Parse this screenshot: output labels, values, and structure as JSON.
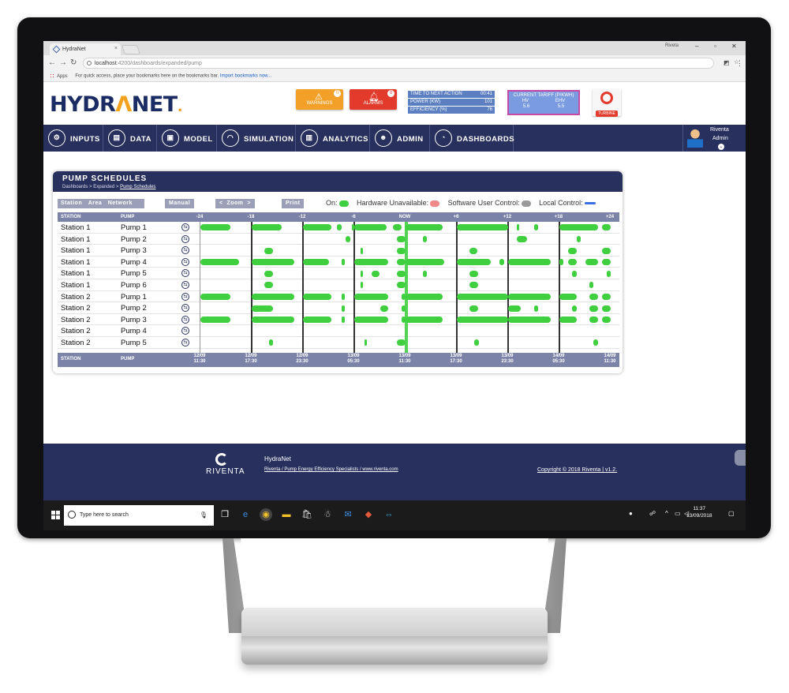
{
  "browser": {
    "tab_title": "HydraNet",
    "tab_close": "×",
    "user_badge": "Riveta",
    "url_host": "localhost",
    "url_path": ":4200/dashboards/expanded/pump",
    "bookmarks_apps": "Apps",
    "bookmarks_hint": "For quick access, place your bookmarks here on the bookmarks bar.",
    "bookmarks_import": "Import bookmarks now..."
  },
  "header": {
    "logo_pre": "HYDR",
    "logo_a": "Λ",
    "logo_post": "NET",
    "logo_dot": ".",
    "warnings_label": "WARNINGS",
    "warnings_count": "0",
    "alarms_label": "ALARMS",
    "alarms_count": "0",
    "stats": [
      {
        "label": "TIME TO NEXT ACTION",
        "value": "00:41"
      },
      {
        "label": "POWER (KW)",
        "value": "101"
      },
      {
        "label": "EFFICIENCY (%)",
        "value": "76"
      }
    ],
    "tariff_title": "CURRENT TARIFF (P/KWH)",
    "tariff_h1": "HV",
    "tariff_h2": "EHV",
    "tariff_v1": "5.6",
    "tariff_v2": "5.5",
    "turbine_label": "TURBINE"
  },
  "nav": {
    "items": [
      "INPUTS",
      "DATA",
      "MODEL",
      "SIMULATION",
      "ANALYTICS",
      "ADMIN",
      "DASHBOARDS"
    ],
    "user_name": "Riventa",
    "user_role": "Admin"
  },
  "panel": {
    "title": "PUMP SCHEDULES",
    "crumb": "Dashboards > Expanded > ",
    "crumb_current": "Pump Schedules",
    "btn_station": "Station",
    "btn_area": "Area",
    "btn_network": "Network",
    "btn_manual": "Manual",
    "btn_zoom": "<  Zoom  >",
    "btn_print": "Print",
    "legend_on": "On:",
    "legend_hw": "Hardware Unavailable:",
    "legend_sw": "Software User Control:",
    "legend_local": "Local Control:"
  },
  "grid": {
    "col_station": "STATION",
    "col_pump": "PUMP",
    "ticks": [
      "-24",
      "-18",
      "-12",
      "-6",
      "NOW",
      "+6",
      "+12",
      "+18",
      "+24"
    ],
    "foot_times": [
      [
        "12/09",
        "11:30"
      ],
      [
        "12/09",
        "17:30"
      ],
      [
        "12/09",
        "23:30"
      ],
      [
        "13/09",
        "05:30"
      ],
      [
        "13/09",
        "11:30"
      ],
      [
        "13/09",
        "17:30"
      ],
      [
        "13/09",
        "23:30"
      ],
      [
        "14/09",
        "05:30"
      ],
      [
        "14/09",
        "11:30"
      ]
    ],
    "rows": [
      {
        "station": "Station 1",
        "pump": "Pump 1",
        "on_hours": [
          [
            -24,
            -20.5
          ],
          [
            -18,
            -14.5
          ],
          [
            -12,
            -8.7
          ],
          [
            -8,
            -7.5
          ],
          [
            -6.3,
            -6
          ],
          [
            -6,
            -2.2
          ],
          [
            -1.5,
            -0.5
          ],
          [
            0,
            4.3
          ],
          [
            6,
            12
          ],
          [
            13,
            13.3
          ],
          [
            15,
            15.5
          ],
          [
            18,
            22.5
          ],
          [
            23,
            24
          ]
        ]
      },
      {
        "station": "Station 1",
        "pump": "Pump 2",
        "on_hours": [
          [
            -7,
            -6.5
          ],
          [
            -1,
            0
          ],
          [
            2,
            2.5
          ],
          [
            13,
            14.2
          ],
          [
            20,
            20.5
          ]
        ]
      },
      {
        "station": "Station 1",
        "pump": "Pump 3",
        "on_hours": [
          [
            -16.5,
            -15.5
          ],
          [
            -5.3,
            -5.1
          ],
          [
            -1,
            0
          ],
          [
            7.5,
            8.4
          ],
          [
            19,
            20
          ],
          [
            23,
            24
          ]
        ]
      },
      {
        "station": "Station 1",
        "pump": "Pump 4",
        "on_hours": [
          [
            -24,
            -19.5
          ],
          [
            -18,
            -13
          ],
          [
            -12,
            -9
          ],
          [
            -7.5,
            -7.1
          ],
          [
            -6,
            -2
          ],
          [
            -1,
            0
          ],
          [
            0,
            4.5
          ],
          [
            6,
            10
          ],
          [
            11,
            11.5
          ],
          [
            12,
            17
          ],
          [
            18,
            18.5
          ],
          [
            19,
            20
          ],
          [
            21,
            22.5
          ],
          [
            23,
            24
          ]
        ]
      },
      {
        "station": "Station 1",
        "pump": "Pump 5",
        "on_hours": [
          [
            -16.5,
            -15.5
          ],
          [
            -5.3,
            -5.1
          ],
          [
            -4,
            -3
          ],
          [
            -1,
            0
          ],
          [
            2,
            2.5
          ],
          [
            7.5,
            8.5
          ],
          [
            19.5,
            20
          ],
          [
            23.5,
            24
          ]
        ]
      },
      {
        "station": "Station 1",
        "pump": "Pump 6",
        "on_hours": [
          [
            -16.5,
            -15.5
          ],
          [
            -5.3,
            -5.1
          ],
          [
            -1,
            0
          ],
          [
            7.5,
            8.5
          ],
          [
            21.5,
            22
          ]
        ]
      },
      {
        "station": "Station 2",
        "pump": "Pump 1",
        "on_hours": [
          [
            -24,
            -20.5
          ],
          [
            -18,
            -13
          ],
          [
            -12,
            -8.7
          ],
          [
            -7.5,
            -7.1
          ],
          [
            -6,
            -2
          ],
          [
            -0.5,
            0
          ],
          [
            0,
            4.3
          ],
          [
            6,
            12
          ],
          [
            12,
            17
          ],
          [
            18,
            20
          ],
          [
            21.5,
            22.5
          ],
          [
            23,
            24
          ]
        ]
      },
      {
        "station": "Station 2",
        "pump": "Pump 2",
        "on_hours": [
          [
            -18,
            -15.5
          ],
          [
            -7.5,
            -7.1
          ],
          [
            -3,
            -2
          ],
          [
            -0.5,
            0
          ],
          [
            7.5,
            8.5
          ],
          [
            12,
            13.5
          ],
          [
            15,
            15.5
          ],
          [
            19.5,
            20
          ],
          [
            21.5,
            22.5
          ],
          [
            23,
            24
          ]
        ]
      },
      {
        "station": "Station 2",
        "pump": "Pump 3",
        "on_hours": [
          [
            -24,
            -20.5
          ],
          [
            -18,
            -13
          ],
          [
            -12,
            -8.7
          ],
          [
            -7.5,
            -7.1
          ],
          [
            -6,
            -2
          ],
          [
            -0.5,
            0
          ],
          [
            0,
            4.3
          ],
          [
            6,
            12
          ],
          [
            12,
            17
          ],
          [
            18,
            20
          ],
          [
            21.5,
            22.5
          ],
          [
            23,
            24
          ]
        ]
      },
      {
        "station": "Station 2",
        "pump": "Pump 4",
        "on_hours": []
      },
      {
        "station": "Station 2",
        "pump": "Pump 5",
        "on_hours": [
          [
            -16,
            -15.5
          ],
          [
            -4.8,
            -4.6
          ],
          [
            -1,
            0
          ],
          [
            8,
            8.6
          ],
          [
            22,
            22.5
          ]
        ]
      }
    ]
  },
  "footer": {
    "logo_text": "RIVENTA",
    "app_name": "HydraNet",
    "subline": "Riventa / Pump Energy Efficiency Specialists / www.riventa.com",
    "copyright": "Copyright © 2018 Riventa | v1.2."
  },
  "taskbar": {
    "search_placeholder": "Type here to search",
    "time": "11:37",
    "date": "13/09/2018"
  }
}
